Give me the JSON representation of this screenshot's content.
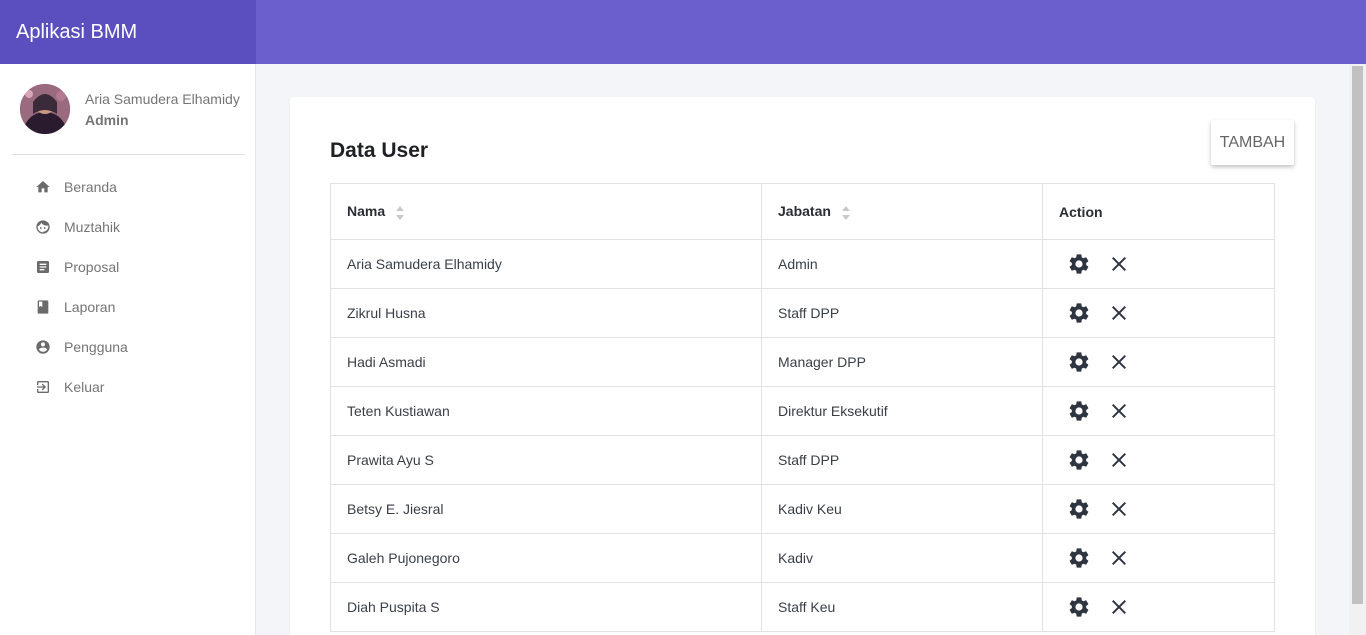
{
  "app": {
    "title": "Aplikasi BMM"
  },
  "profile": {
    "name": "Aria Samudera Elhamidy",
    "role": "Admin"
  },
  "nav": [
    {
      "label": "Beranda",
      "icon": "home-icon"
    },
    {
      "label": "Muztahik",
      "icon": "face-icon"
    },
    {
      "label": "Proposal",
      "icon": "document-icon"
    },
    {
      "label": "Laporan",
      "icon": "book-icon"
    },
    {
      "label": "Pengguna",
      "icon": "user-circle-icon"
    },
    {
      "label": "Keluar",
      "icon": "logout-icon"
    }
  ],
  "page": {
    "title": "Data User",
    "add_label": "TAMBAH"
  },
  "table": {
    "headers": {
      "nama": "Nama",
      "jabatan": "Jabatan",
      "action": "Action"
    },
    "rows": [
      {
        "nama": "Aria Samudera Elhamidy",
        "jabatan": "Admin"
      },
      {
        "nama": "Zikrul Husna",
        "jabatan": "Staff DPP"
      },
      {
        "nama": "Hadi Asmadi",
        "jabatan": "Manager DPP"
      },
      {
        "nama": "Teten Kustiawan",
        "jabatan": "Direktur Eksekutif"
      },
      {
        "nama": "Prawita Ayu S",
        "jabatan": "Staff DPP"
      },
      {
        "nama": "Betsy E. Jiesral",
        "jabatan": "Kadiv Keu"
      },
      {
        "nama": "Galeh Pujonegoro",
        "jabatan": "Kadiv"
      },
      {
        "nama": "Diah Puspita S",
        "jabatan": "Staff Keu"
      }
    ]
  },
  "colors": {
    "topbar": "#6a5fcc",
    "brand": "#5b4fc0",
    "icon": "#2e3440"
  }
}
